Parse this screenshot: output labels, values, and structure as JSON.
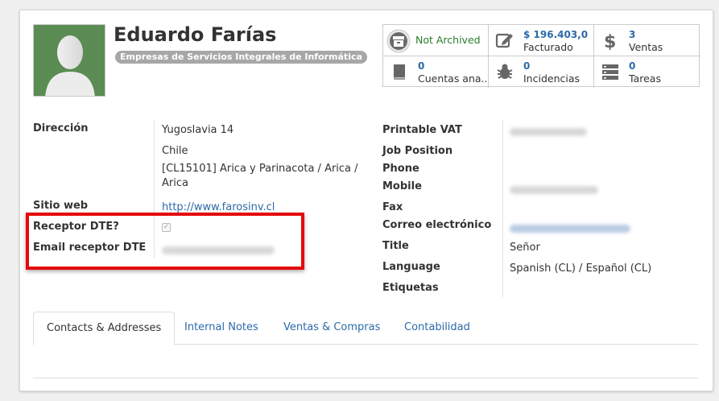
{
  "partner": {
    "name": "Eduardo Farías",
    "tag": "Empresas de Servicios Integrales de Informática"
  },
  "stats": {
    "archived": "Not Archived",
    "invoiced_value": "$ 196.403,0",
    "invoiced_label": "Facturado",
    "sales_value": "3",
    "sales_label": "Ventas",
    "accounts_value": "0",
    "accounts_label": "Cuentas ana..",
    "issues_value": "0",
    "issues_label": "Incidencias",
    "tasks_value": "0",
    "tasks_label": "Tareas"
  },
  "left_fields": {
    "address_label": "Dirección",
    "street": "Yugoslavia 14",
    "country": "Chile",
    "state_line1": "[CL15101] Arica y Parinacota / Arica /",
    "state_line2": "Arica",
    "website_label": "Sitio web",
    "website": "http://www.farosinv.cl",
    "dte_receiver_label": "Receptor DTE?",
    "dte_email_label": "Email receptor DTE"
  },
  "right_fields": {
    "vat_label": "Printable VAT",
    "job_label": "Job Position",
    "phone_label": "Phone",
    "mobile_label": "Mobile",
    "fax_label": "Fax",
    "email_label": "Correo electrónico",
    "title_label": "Title",
    "title_value": "Señor",
    "language_label": "Language",
    "language_value": "Spanish (CL) / Español (CL)",
    "tags_label": "Etiquetas"
  },
  "tabs": [
    "Contacts & Addresses",
    "Internal Notes",
    "Ventas & Compras",
    "Contabilidad"
  ],
  "colors": {
    "link": "#2c6aa8",
    "highlight_box": "#e5090c",
    "avatar_bg": "#5b8c53",
    "tag_bg": "#a7a7a7"
  },
  "icons": {
    "archive": "archive-icon",
    "invoiced": "pencil-square-icon",
    "sales": "dollar-icon",
    "accounts": "book-icon",
    "issues": "bug-icon",
    "tasks": "tasks-icon"
  }
}
